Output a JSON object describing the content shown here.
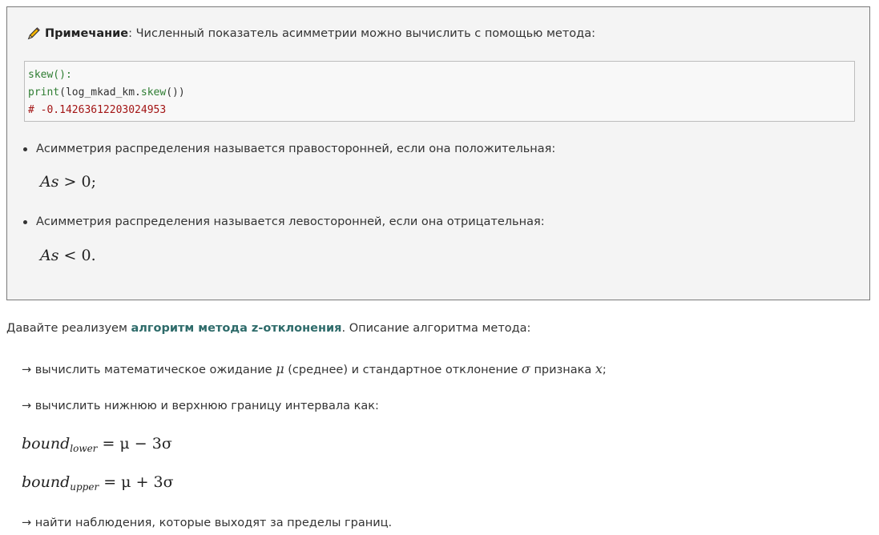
{
  "note": {
    "title": "Примечание",
    "text": ": Численный показатель асимметрии можно вычислить с помощью метода:",
    "code": {
      "line1": "skew():",
      "line2_func": "print",
      "line2_open": "(log_mkad_km.",
      "line2_method": "skew",
      "line2_close": "())",
      "line3": "# -0.14263612203024953"
    },
    "bullet1": "Асимметрия распределения называется правосторонней, если она положительная:",
    "formula1": {
      "var": "As",
      "rest": " > 0;"
    },
    "bullet2": "Асимметрия распределения называется левосторонней, если она отрицательная:",
    "formula2": {
      "var": "As",
      "rest": " < 0."
    }
  },
  "intro": {
    "before": "Давайте реализуем ",
    "bold": "алгоритм метода z-отклонения",
    "after": ". Описание алгоритма метода:"
  },
  "step1": {
    "a": "→ вычислить математическое ожидание ",
    "mu": "μ",
    "b": " (среднее) и стандартное отклонение ",
    "sigma": "σ",
    "c": " признака ",
    "x": "x",
    "d": ";"
  },
  "step2": "→ вычислить нижнюю и верхнюю границу интервала как:",
  "bound_lower": {
    "base": "bound",
    "sub": "lower",
    "rest": " = μ − 3σ"
  },
  "bound_upper": {
    "base": "bound",
    "sub": "upper",
    "rest": " = μ + 3σ"
  },
  "step3": "→ найти наблюдения, которые выходят за пределы границ."
}
